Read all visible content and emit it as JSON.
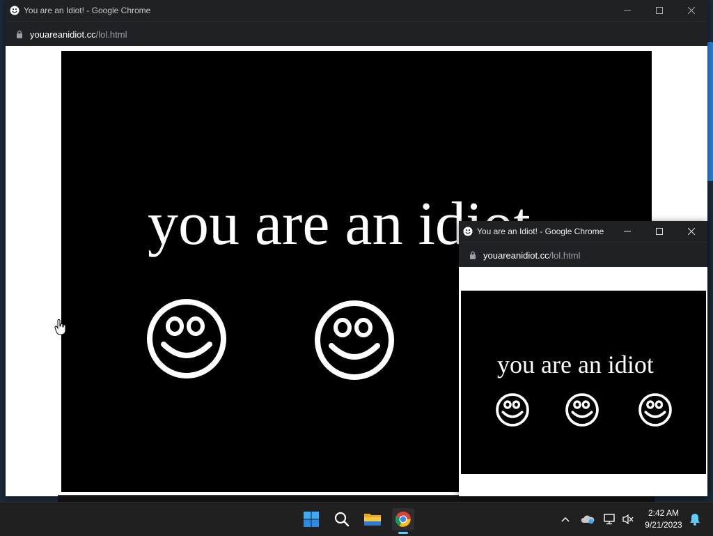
{
  "windows": {
    "main": {
      "title": "You are an Idiot! - Google Chrome",
      "url_domain": "youareanidiot.cc",
      "url_path": "/lol.html",
      "message": "you are an idiot"
    },
    "popup": {
      "title": "You are an Idiot! - Google Chrome",
      "url_domain": "youareanidiot.cc",
      "url_path": "/lol.html",
      "message": "you are an idiot"
    }
  },
  "taskbar": {
    "apps": [
      "start-icon",
      "search-icon",
      "file-explorer-icon",
      "chrome-icon"
    ],
    "tray_icons": [
      "chevron-up-icon",
      "onedrive-icon",
      "network-icon",
      "volume-muted-icon",
      "notification-bell-icon"
    ],
    "time": "2:42 AM",
    "date": "9/21/2023"
  },
  "colors": {
    "titlebar": "#202124",
    "stage": "#000000",
    "taskbar": "#202020",
    "accent": "#60cdff"
  }
}
